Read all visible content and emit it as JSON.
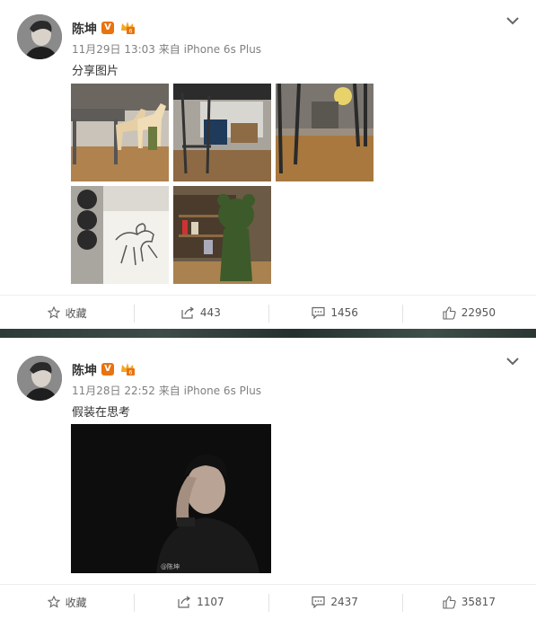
{
  "posts": [
    {
      "author": "陈坤",
      "verified_badge": "V",
      "timestamp": "11月29日 13:03",
      "source_prefix": "来自",
      "source": "iPhone 6s Plus",
      "text": "分享图片",
      "images": [
        "horse-figurines-photo",
        "chair-desk-photo",
        "room-floor-photo",
        "horse-drawing-photo",
        "green-figure-shelf-photo"
      ],
      "actions": {
        "favorite_label": "收藏",
        "repost_count": "443",
        "comment_count": "1456",
        "like_count": "22950"
      }
    },
    {
      "author": "陈坤",
      "verified_badge": "V",
      "timestamp": "11月28日 22:52",
      "source_prefix": "来自",
      "source": "iPhone 6s Plus",
      "text": "假装在思考",
      "images": [
        "portrait-photo"
      ],
      "image_watermark": "@陈坤",
      "actions": {
        "favorite_label": "收藏",
        "repost_count": "1107",
        "comment_count": "2437",
        "like_count": "35817"
      }
    }
  ],
  "colors": {
    "badge": "#e8730f",
    "meta": "#808080",
    "icon": "#666666"
  }
}
